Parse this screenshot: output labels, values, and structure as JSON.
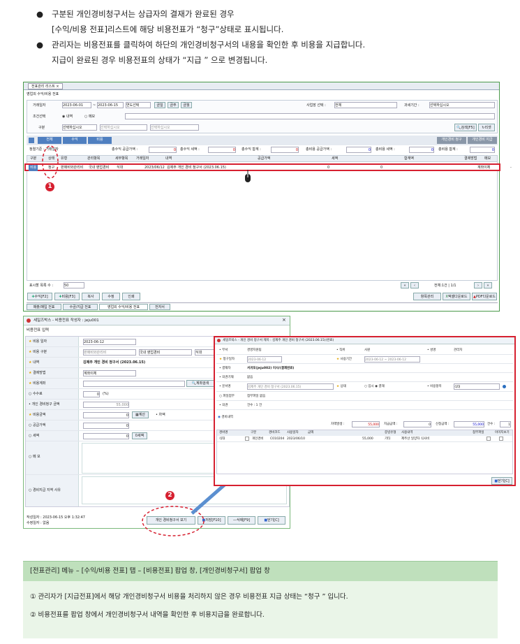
{
  "intro": {
    "b1_l1": "구분된 개인경비청구서는 상급자의 결재가 완료된 경우",
    "b1_l2": "[수익/비용 전표]리스트에 해당 비용전표가 “청구”상태로 표시됩니다.",
    "b2_l1": "관리자는 비용전표를 클릭하여 하단의 개인경비청구서의 내용을 확인한 후 비용을 지급합니다.",
    "b2_l2": "지급이 완료된 경우 비용전표의 상태가 “지급 ” 으로 변경됩니다."
  },
  "list_window": {
    "tab": "전표관리 리스트 ×",
    "subtab": "영업외 수익/비용 전표",
    "filter": {
      "date_label": "거래일자",
      "date_from": "2023-06-01",
      "date_to": "2023-06-15",
      "period": "연도선택",
      "btn_day": "금일",
      "btn_week": "금주",
      "btn_month": "금월",
      "type_label": "조건선택",
      "radio1": "내역",
      "radio2": "메모",
      "div_label": "구분",
      "sel1": "선택하십시오",
      "sel2": "선택하십시오",
      "sel3": "선택하십시오",
      "biz_label": "사업장 선택 :",
      "biz_val": "전체",
      "tax_label": "과세기간 :",
      "tax_val": "선택하십시오",
      "search_btn": "검색[F5]",
      "reset_btn": "리셋"
    },
    "tabs": [
      "전체",
      "수익",
      "비용"
    ],
    "right_btns": [
      "개인경비 청구",
      "개인경비 지급"
    ],
    "summary": {
      "period": "정렬기준 : 거래일자",
      "supply": "총수익 공급가액 :",
      "supply_v": "0",
      "tax": "총수익 세액 :",
      "tax_v": "0",
      "sum": "총수익 합계 :",
      "sum_v": "0",
      "exp": "총비용 공급가액 :",
      "exp_v": "0",
      "exptax": "총비용 세액 :",
      "exptax_v": "0",
      "expsum": "총비용 합계 :",
      "expsum_v": "0"
    },
    "columns": [
      "구분",
      "상태",
      "유형",
      "관리항목",
      "세부항목",
      "거래일자",
      "내역",
      "공급가액",
      "세액",
      "합계액",
      "결제방법",
      "메모"
    ],
    "row": [
      "비용",
      "청구",
      "판매비와관리비",
      "국내 영업경비",
      "식대",
      "2023/06/12",
      "김제주 개인 경비 청구서 (2023.06.15)",
      "",
      "0",
      "0",
      "계좌이체",
      "-"
    ],
    "footer": {
      "rows_label": "표시할 목록 수 :",
      "rows_val": "50",
      "page": "전체:1건 | 1/1"
    },
    "bottom_btns": [
      "수익[F2]",
      "비용[F3]",
      "복사",
      "수정",
      "인쇄"
    ],
    "bottom_right": [
      "항목관리",
      "엑셀다운로드",
      "PDF다운로드"
    ],
    "bottom_tabs": [
      "매출/매입 전표",
      "수금/지급 전표",
      "영업외 수익/비용 전표",
      "전자서"
    ]
  },
  "cost_window": {
    "title": "세일즈박스 - 비용전표  작성자 : jeju001",
    "subtitle": "비용전표 입력",
    "fields": [
      {
        "label": "비용 일자",
        "value": "2023-06-12"
      },
      {
        "label": "비용 구분",
        "value": "판매비와관리비",
        "extra": "국내 영업경비",
        "extra2": "식대"
      },
      {
        "label": "내역",
        "value": "김제주 개인 경비 청구서 (2023.06.15)"
      },
      {
        "label": "결제방법",
        "value": "계좌이체"
      },
      {
        "label": "비용계좌",
        "value": "",
        "btn": "계좌검색"
      },
      {
        "label": "수수료",
        "value": "0",
        "unit": "(%)"
      },
      {
        "label": "개인 경비청구 금액",
        "value": "55,000"
      },
      {
        "label": "비용금액",
        "value": "0",
        "btn": "계산",
        "extra": "• 차액"
      },
      {
        "label": "공급가액",
        "value": "0"
      },
      {
        "label": "세액",
        "value": "0",
        "btn": "0세액"
      },
      {
        "label": "메 모",
        "value": ""
      },
      {
        "label": "경비지급 지역 사유",
        "value": ""
      }
    ],
    "created": "작성일자 : 2023-06-15 오후 1:32:47",
    "modified": "수정일자 : 없음",
    "btn_view": "개인 경비청구서 보기",
    "btn_save": "저장[F10]",
    "btn_del": "삭제[F9]",
    "btn_close": "닫기[C]"
  },
  "expense_window": {
    "title": "세일즈박스 - 개인 경비 청구서 제목 : 김제주 개인 경비 청구서 (2023.06.15)(완료)",
    "r1": {
      "l1": "부서",
      "v1": "경영지원팀",
      "l2": "직위",
      "v2": "사원",
      "l3": "성명",
      "v3": "관리자"
    },
    "r2": {
      "l1": "청구일자",
      "v1": "2023-06-12",
      "l2": "사용기간",
      "v2": "2023-06-12 ~ 2023-06-12"
    },
    "r3": {
      "l1": "결재자",
      "v1": "서귀포(jeju002) 이사/(결재완료)"
    },
    "r4": {
      "l1": "의견기재",
      "v1": "없음"
    },
    "r5": {
      "l1": "문서명",
      "v1": "김제주 개인 경비 청구서 (2023.06.15)",
      "l2": "상태",
      "v2": "○ 임시 ◉ 결재",
      "l3": "비용항목",
      "v3": "식대"
    },
    "r6": {
      "l1": "파일첨부",
      "v1": "첨부파일 없음"
    },
    "r7": {
      "l1": "의견",
      "v1": "건수 : 1 건"
    },
    "detail_title": "경비내역",
    "totals": {
      "diff": "차액발생 :",
      "diff_v": "55,000",
      "paid": "지급금액 :",
      "paid_v": "0",
      "req": "신청금액 :",
      "req_v": "55,000",
      "cnt": "건수 :",
      "cnt_v": "1"
    },
    "columns": [
      "경비명",
      "구분",
      "경비코드",
      "사용일자",
      "금액",
      "증빙유형",
      "사용내역",
      "첨부파일",
      "이미지보기"
    ],
    "row": [
      "식대",
      "",
      "개인경비",
      "C010204",
      "2023/06/10",
      "55,000",
      "기타",
      "제주산 일양자 식사비"
    ],
    "close": "닫기[C]"
  },
  "markers": {
    "m1": "1",
    "m2": "2"
  },
  "caption": {
    "head": "[전표관리] 메뉴 – [수익/비용 전표] 탭 – [비용전표] 팝업 창, [개인경비청구서] 팝업 창",
    "line1": "①  관리자가 [지급전표]에서 해당 개인경비청구서 비용을 처리하지 않은 경우 비용전표 지급 상태는  “청구 ” 입니다.",
    "line2": "②  비용전표를 팝업 창에서 개인경비청구서 내역을 확인한 후 비용지급을 완료합니다."
  }
}
